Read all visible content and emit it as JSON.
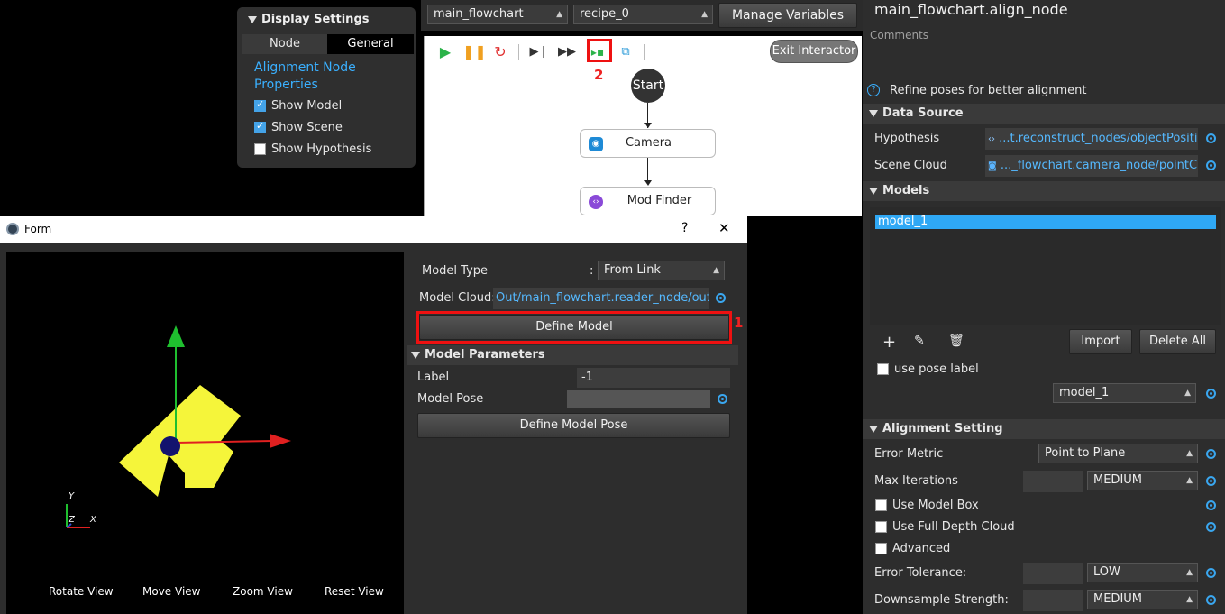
{
  "display_settings": {
    "header": "Display Settings",
    "tabs": [
      "Node",
      "General"
    ],
    "props_title": "Alignment Node Properties",
    "checks": [
      {
        "label": "Show Model",
        "checked": true
      },
      {
        "label": "Show Scene",
        "checked": true
      },
      {
        "label": "Show Hypothesis",
        "checked": false
      }
    ]
  },
  "topbar": {
    "flowchart_select": "main_flowchart",
    "recipe_select": "recipe_0",
    "manage_vars": "Manage Variables"
  },
  "canvas": {
    "exit_label": "Exit Interactor",
    "annotation_2": "2",
    "nodes": {
      "start": "Start",
      "camera": "Camera",
      "mod_finder": "Mod Finder"
    }
  },
  "right": {
    "title": "main_flowchart.align_node",
    "comments": "Comments",
    "help_text": "Refine poses for better alignment",
    "data_source": {
      "header": "Data Source",
      "hypothesis_label": "Hypothesis",
      "hypothesis_value": "...t.reconstruct_nodes/objectPositions",
      "scene_label": "Scene Cloud",
      "scene_value": "..._flowchart.camera_node/pointCloud"
    },
    "models": {
      "header": "Models",
      "items": [
        "model_1"
      ],
      "import_label": "Import",
      "delete_all_label": "Delete All",
      "use_pose_label": "use pose label",
      "model_select": "model_1"
    },
    "alignment": {
      "header": "Alignment Setting",
      "error_metric_label": "Error Metric",
      "error_metric_value": "Point to Plane",
      "max_iter_label": "Max Iterations",
      "max_iter_value": "MEDIUM",
      "use_model_box": "Use Model Box",
      "use_full_depth": "Use Full Depth Cloud",
      "advanced": "Advanced",
      "error_tol_label": "Error Tolerance:",
      "error_tol_value": "LOW",
      "downsample_label": "Downsample Strength:",
      "downsample_value": "MEDIUM"
    }
  },
  "form": {
    "title": "Form",
    "help": "?",
    "close": "✕",
    "model_type_label": "Model Type",
    "model_type_value": "From Link",
    "model_cloud_label": "Model Cloud:",
    "model_cloud_value": "Out/main_flowchart.reader_node/outputC",
    "define_model": "Define Model",
    "annotation_1": "1",
    "params_header": "Model Parameters",
    "label_label": "Label",
    "label_value": "-1",
    "model_pose_label": "Model Pose",
    "define_model_pose": "Define Model Pose",
    "axes": {
      "y": "Y",
      "z": "Z",
      "x": "X"
    },
    "view_buttons": [
      "Rotate View",
      "Move View",
      "Zoom View",
      "Reset View"
    ]
  },
  "colors": {
    "accent": "#3ab0ff",
    "annotation": "#e11111",
    "selection": "#2fa8f5",
    "model_yellow": "#f5f53a"
  }
}
